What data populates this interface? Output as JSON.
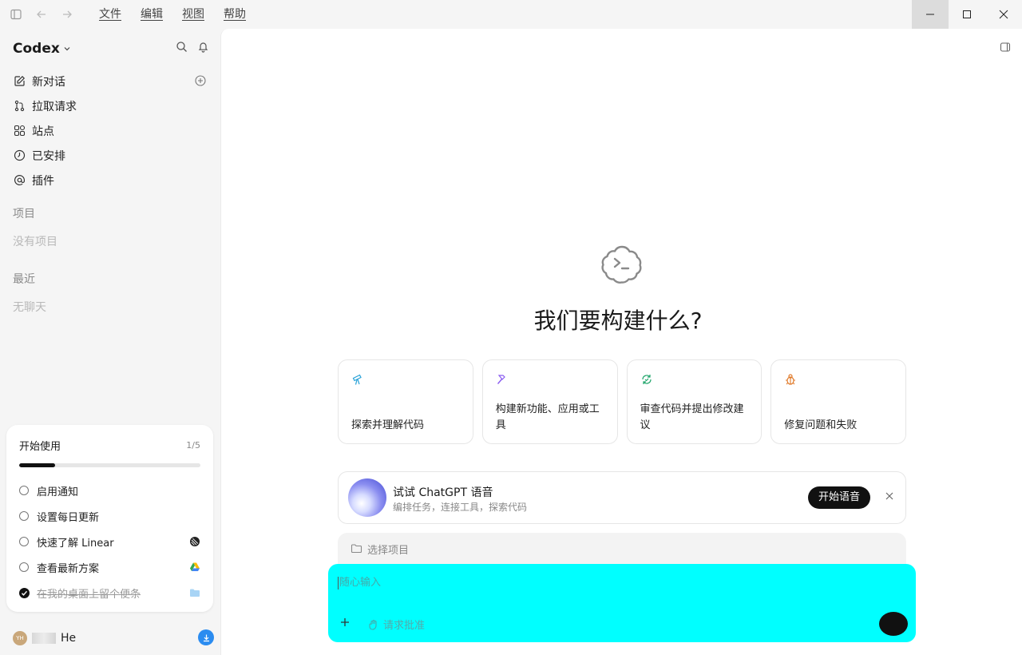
{
  "menubar": {
    "items": [
      "文件",
      "编辑",
      "视图",
      "帮助"
    ]
  },
  "sidebar": {
    "brand": "Codex",
    "nav": [
      {
        "label": "新对话",
        "icon": "edit-icon"
      },
      {
        "label": "拉取请求",
        "icon": "pull-request-icon"
      },
      {
        "label": "站点",
        "icon": "sites-icon"
      },
      {
        "label": "已安排",
        "icon": "clock-icon"
      },
      {
        "label": "插件",
        "icon": "at-icon"
      }
    ],
    "projects_title": "项目",
    "projects_empty": "没有项目",
    "recent_title": "最近",
    "recent_empty": "无聊天"
  },
  "onboarding": {
    "title": "开始使用",
    "count": "1/5",
    "progress": 0.2,
    "items": [
      {
        "label": "启用通知",
        "done": false
      },
      {
        "label": "设置每日更新",
        "done": false
      },
      {
        "label": "快速了解 Linear",
        "done": false
      },
      {
        "label": "查看最新方案",
        "done": false
      },
      {
        "label": "在我的桌面上留个便条",
        "done": true
      }
    ]
  },
  "user": {
    "avatar_initials": "YH",
    "name": "He"
  },
  "main": {
    "hero_title": "我们要构建什么?",
    "cards": [
      {
        "label": "探索并理解代码",
        "icon": "telescope-icon",
        "color": "#27a2d8"
      },
      {
        "label": "构建新功能、应用或工具",
        "icon": "hammer-icon",
        "color": "#8a5cf0"
      },
      {
        "label": "审查代码并提出修改建议",
        "icon": "review-icon",
        "color": "#1fa56a"
      },
      {
        "label": "修复问题和失败",
        "icon": "bug-icon",
        "color": "#e07a2a"
      }
    ],
    "voice": {
      "title": "试试 ChatGPT 语音",
      "subtitle": "编排任务，连接工具，探索代码",
      "button": "开始语音"
    },
    "project_select": "选择项目",
    "composer": {
      "placeholder": "随心输入",
      "mode": "请求批准"
    }
  }
}
